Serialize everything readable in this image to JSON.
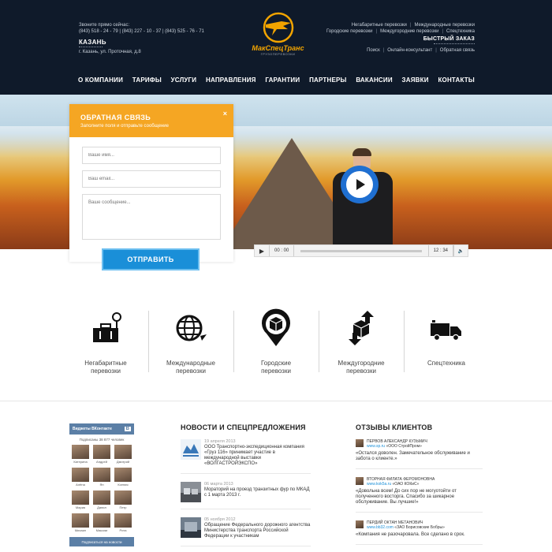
{
  "header": {
    "call_label": "Звоните прямо сейчас:",
    "phones": "(843) 518 - 24 - 79   |   (843) 227 - 10 - 37   |   (843) 525 - 76 - 71",
    "city": "КАЗАНЬ",
    "address": "г. Казань, ул. Проточная, д.8",
    "brand": "МакСпецТранс",
    "brand_sub": "ГРУЗОПЕРЕВОЗКИ",
    "top_links_row1": [
      "Негабаритные перевозки",
      "Международные перевозки"
    ],
    "top_links_row2": [
      "Городские перевозки",
      "Междугородние перевозки",
      "Спецтехника"
    ],
    "quick_order": "БЫСТРЫЙ ЗАКАЗ",
    "util_links": [
      "Поиск",
      "Онлайн-консультант",
      "Обратная связь"
    ],
    "nav": [
      "О КОМПАНИИ",
      "ТАРИФЫ",
      "УСЛУГИ",
      "НАПРАВЛЕНИЯ",
      "ГАРАНТИИ",
      "ПАРТНЕРЫ",
      "ВАКАНСИИ",
      "ЗАЯВКИ",
      "КОНТАКТЫ"
    ]
  },
  "feedback": {
    "title": "ОБРАТНАЯ СВЯЗЬ",
    "subtitle": "Заполните поля и отправьте сообщение",
    "close": "×",
    "name_placeholder": "Ваше имя...",
    "email_placeholder": "Ваш email...",
    "message_placeholder": "Ваше сообщение...",
    "send": "ОТПРАВИТЬ"
  },
  "player": {
    "current": "00 : 00",
    "duration": "12 : 34"
  },
  "services": [
    {
      "icon": "scale-luggage-icon",
      "label_1": "Негабаритные",
      "label_2": "перевозки"
    },
    {
      "icon": "globe-icon",
      "label_1": "Международные",
      "label_2": "перевозки"
    },
    {
      "icon": "map-pin-box-icon",
      "label_1": "Городские",
      "label_2": "перевозки"
    },
    {
      "icon": "arrows-box-icon",
      "label_1": "Междугородние",
      "label_2": "перевозки"
    },
    {
      "icon": "truck-icon",
      "label_1": "Спецтехника",
      "label_2": ""
    }
  ],
  "vk": {
    "title": "Виджеты ВКонтакте",
    "badge": "В",
    "count": "Подписаны 38 877 человек",
    "members": [
      "Катерина",
      "Андрей",
      "Дмитрий",
      "Алёна",
      "Ян",
      "Ксения",
      "Мария",
      "Данил",
      "Петр",
      "Михаил",
      "Максим",
      "Рита"
    ],
    "subscribe": "Подписаться на новости"
  },
  "news": {
    "title": "НОВОСТИ И СПЕЦПРЕДЛОЖЕНИЯ",
    "items": [
      {
        "date": "19 апреля 2013",
        "text": "ООО Транспортно-экспедиционная компания «Груз 116» принимает участие в международной выставки «ВОЛГАСТРОЙЭКСПО»"
      },
      {
        "date": "06 марта 2013",
        "text": "Мораторий на проезд транзитных фур по МКАД с 1 марта 2013 г."
      },
      {
        "date": "05 ноября 2012",
        "text": "Обращение Федерального дорожного агентства Министерства транспорта Российской Федерации к участникам"
      }
    ]
  },
  "reviews": {
    "title": "ОТЗЫВЫ КЛИЕНТОВ",
    "items": [
      {
        "name": "ПЕРВОВ АЛЕКСАНДР КУЗЬМИЧ",
        "site": "www.sp.ru",
        "company": "«ООО СтройПром»",
        "text": "«Остался доволен. Замечательное обслуживание и забота о клиенте.»"
      },
      {
        "name": "ВТОРНАЯ ФИЛАТА ФЕРОМОНОВНА",
        "site": "www.kok5a.ru",
        "company": "«ОАО КОКиС»",
        "text": "«Довольна всем! До сих пор не могуотойти от полученного восторга. Спасибо за шикарное обслуживание. Вы лучшие!»"
      },
      {
        "name": "ПЕРДИЙ ОКТАН МЕТАНОВИЧ",
        "site": "www.bb32.com",
        "company": "«ЗАО Борисовские Бобры»",
        "text": "«Компания не разочаровала. Все сделано в срок."
      }
    ]
  },
  "colors": {
    "header_bg": "#0f1a2a",
    "accent_orange": "#f5a623",
    "button_blue": "#1a8fd8",
    "vk_blue": "#5b7fa6"
  }
}
